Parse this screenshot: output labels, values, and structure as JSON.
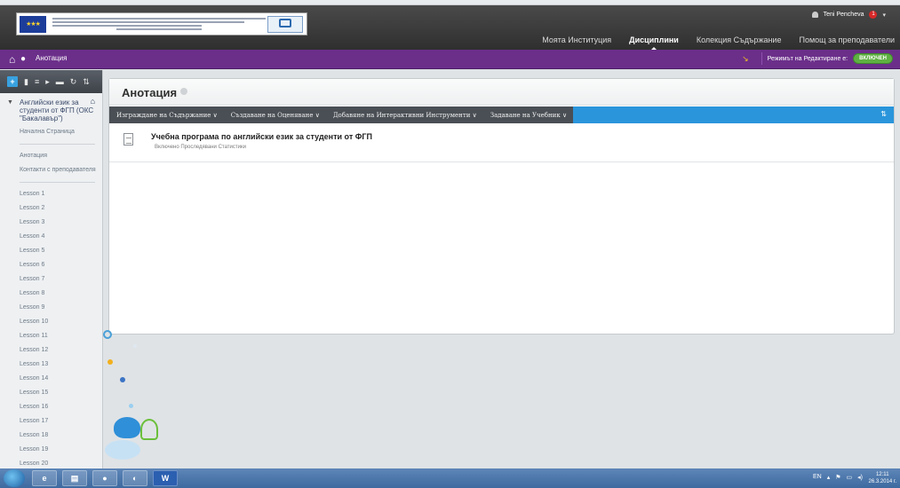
{
  "header": {
    "user_name": "Teni Pencheva",
    "notifications_count": "1",
    "tabs": [
      {
        "label": "Моята Институция",
        "active": false
      },
      {
        "label": "Дисциплини",
        "active": true
      },
      {
        "label": "Колекция Съдържание",
        "active": false
      },
      {
        "label": "Помощ за преподаватели",
        "active": false
      }
    ]
  },
  "course_bar": {
    "breadcrumb": "Анотация",
    "edit_mode_label": "Режимът на Редактиране е:",
    "edit_mode_value": "ВКЛЮЧЕН"
  },
  "sidebar": {
    "course_title": "Английски език за студенти от ФГП (ОКС \"Бакалавър\")",
    "items_top": [
      "Начална Страница"
    ],
    "items_mid": [
      "Анотация",
      "Контакти с преподавателя"
    ],
    "lessons": [
      "Lesson 1",
      "Lesson 2",
      "Lesson 3",
      "Lesson 4",
      "Lesson 5",
      "Lesson 6",
      "Lesson 7",
      "Lesson 8",
      "Lesson 9",
      "Lesson 10",
      "Lesson 11",
      "Lesson 12",
      "Lesson 13",
      "Lesson 14",
      "Lesson 15",
      "Lesson 16",
      "Lesson 17",
      "Lesson 18",
      "Lesson 19",
      "Lesson 20"
    ]
  },
  "main": {
    "page_title": "Анотация",
    "actions": [
      "Изграждане на Съдържание ∨",
      "Създаване на Оценяване ∨",
      "Добавяне на Интерактивни Инструменти ∨",
      "Задаване на Учебник ∨"
    ],
    "item": {
      "title": "Учебна програма по английски език за студенти от ФГП",
      "meta": "Включено   Проследявани Статистики"
    }
  },
  "taskbar": {
    "tray_lang": "EN",
    "time": "12:11",
    "date": "26.3.2014 г."
  },
  "colors": {
    "purple_bar": "#6b2f8a",
    "action_blue": "#2a95db",
    "edit_green": "#5fb043"
  }
}
